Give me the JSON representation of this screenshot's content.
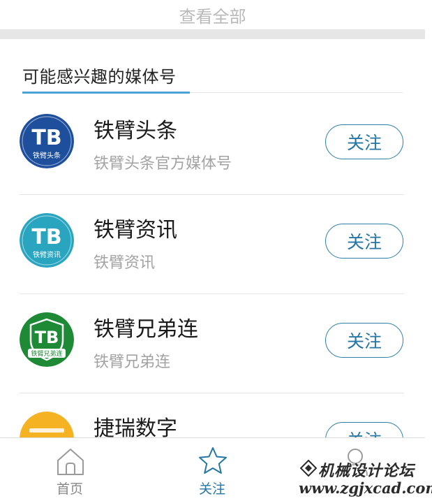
{
  "top_link": {
    "label": "查看全部"
  },
  "section": {
    "title": "可能感兴趣的媒体号"
  },
  "media_list": [
    {
      "name": "铁臂头条",
      "description": "铁臂头条官方媒体号",
      "follow_label": "关注",
      "logo_text": "TB",
      "logo_caption": "铁臂头条",
      "logo_color": "#1d4f9c"
    },
    {
      "name": "铁臂资讯",
      "description": "铁臂资讯",
      "follow_label": "关注",
      "logo_text": "TB",
      "logo_caption": "铁臂资讯",
      "logo_color": "#2aa5c0"
    },
    {
      "name": "铁臂兄弟连",
      "description": "铁臂兄弟连",
      "follow_label": "关注",
      "logo_text": "TB",
      "logo_caption": "铁臂兄弟连",
      "logo_color": "#1e8a36"
    },
    {
      "name": "捷瑞数字",
      "follow_label": "关注",
      "logo_color": "#f5b324"
    }
  ],
  "tab_bar": {
    "tabs": [
      {
        "label": "首页",
        "icon": "home-icon",
        "active": false
      },
      {
        "label": "关注",
        "icon": "star-icon",
        "active": true
      },
      {
        "label": "",
        "icon": "user-icon",
        "active": false
      }
    ]
  },
  "watermark": {
    "title": "机械设计论坛",
    "url": "www.zgjxcad.com"
  },
  "colors": {
    "accent": "#2676a3",
    "separator": "#e6e6e6",
    "muted_text": "#a3a3a3"
  }
}
